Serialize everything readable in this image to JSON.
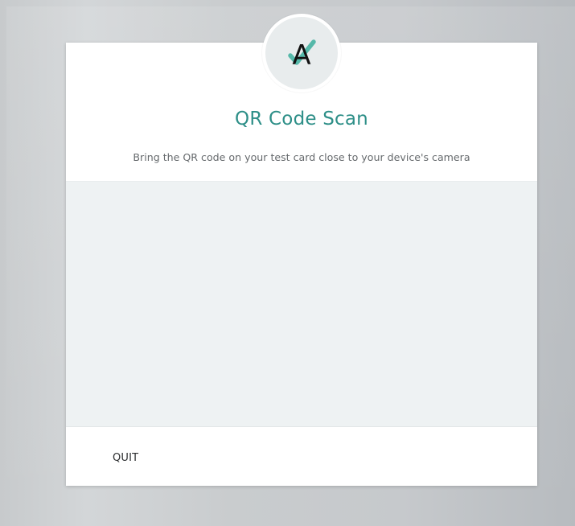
{
  "dialog": {
    "title": "QR Code Scan",
    "instruction": "Bring the QR code on your test card close to your device's camera",
    "quit_label": "QUIT"
  },
  "brand": {
    "logo_letter": "A",
    "accent_color": "#2e8f88",
    "logo_check_color": "#55b8a9"
  },
  "icons": {
    "logo": "brand-a-check-icon"
  }
}
